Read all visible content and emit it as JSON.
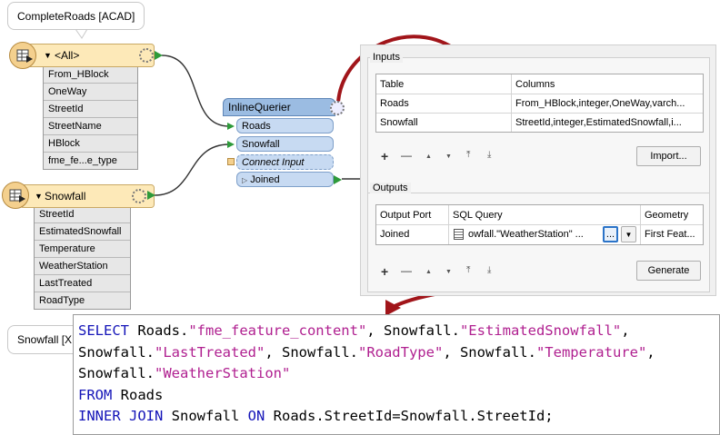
{
  "callouts": {
    "top": "CompleteRoads [ACAD]",
    "bottom": "Snowfall [X"
  },
  "reader_roads": {
    "title": "<All>",
    "attributes": [
      "From_HBlock",
      "OneWay",
      "StreetId",
      "StreetName",
      "HBlock",
      "fme_fe...e_type"
    ]
  },
  "reader_snowfall": {
    "title": "Snowfall",
    "attributes": [
      "StreetId",
      "EstimatedSnowfall",
      "Temperature",
      "WeatherStation",
      "LastTreated",
      "RoadType"
    ]
  },
  "transformer": {
    "title": "InlineQuerier",
    "ports": [
      "Roads",
      "Snowfall"
    ],
    "connect_input": "Connect Input",
    "output": "Joined"
  },
  "inputs": {
    "label": "Inputs",
    "col_table": "Table",
    "col_columns": "Columns",
    "rows": [
      {
        "table": "Roads",
        "columns": "From_HBlock,integer,OneWay,varch..."
      },
      {
        "table": "Snowfall",
        "columns": "StreetId,integer,EstimatedSnowfall,i..."
      }
    ],
    "import_button": "Import..."
  },
  "outputs": {
    "label": "Outputs",
    "col_port": "Output Port",
    "col_sql": "SQL Query",
    "col_geometry": "Geometry",
    "row": {
      "port": "Joined",
      "sql": "owfall.\"WeatherStation\" ...",
      "geometry": "First Feat..."
    },
    "ellipsis_button": "...",
    "generate_button": "Generate"
  },
  "toolbar": {
    "add": "+",
    "remove": "—",
    "up": "▲",
    "down": "▼",
    "top": "⤒",
    "bottom": "⤓"
  },
  "sql": {
    "l1a": "SELECT",
    "l1b": " Roads.",
    "l1c": "\"fme_feature_content\"",
    "l1d": ", Snowfall.",
    "l1e": "\"EstimatedSnowfall\"",
    "l1f": ",",
    "l2a": "Snowfall.",
    "l2b": "\"LastTreated\"",
    "l2c": ", Snowfall.",
    "l2d": "\"RoadType\"",
    "l2e": ", Snowfall.",
    "l2f": "\"Temperature\"",
    "l2g": ",",
    "l3a": "Snowfall.",
    "l3b": "\"WeatherStation\"",
    "l4a": "FROM",
    "l4b": " Roads",
    "l5a": "INNER JOIN",
    "l5b": " Snowfall ",
    "l5c": "ON",
    "l5d": " Roads.StreetId=Snowfall.StreetId;"
  },
  "colors": {
    "arrow": "#a1151a",
    "port_green": "#2e9a3a",
    "keyword": "#1515b8",
    "string": "#b02090"
  }
}
